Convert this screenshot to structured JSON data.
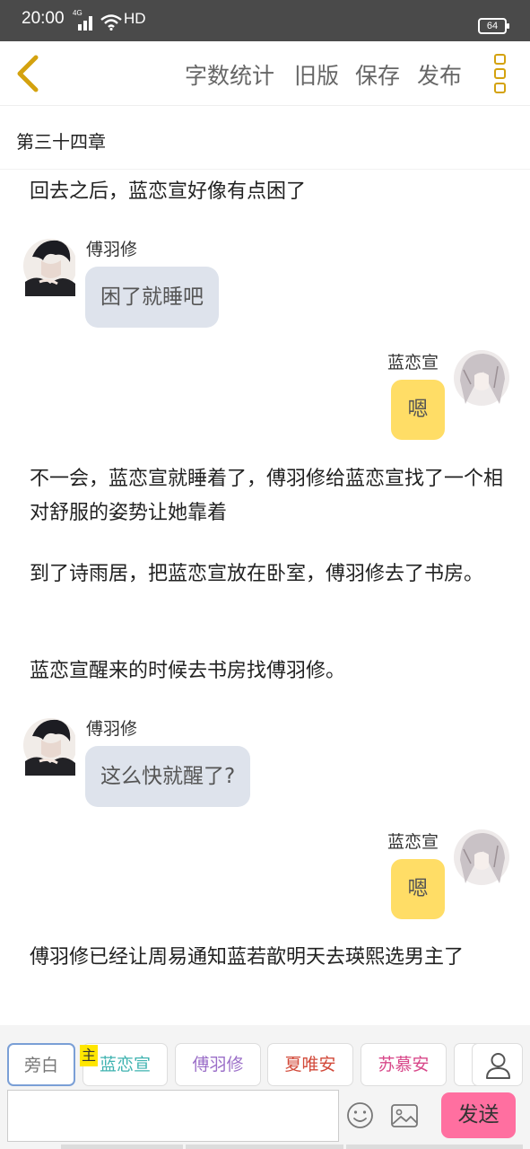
{
  "status_bar": {
    "time": "20:00",
    "network": "4G",
    "hd": "HD",
    "battery": "64"
  },
  "nav": {
    "back_icon": "chevron-left-icon",
    "actions": [
      "字数统计",
      "旧版",
      "保存",
      "发布"
    ],
    "menu_icon": "vertical-menu-icon",
    "accent": "#d4a20f"
  },
  "chapter": {
    "title": "第三十四章"
  },
  "messages": [
    {
      "type": "narration",
      "text": "回去之后，蓝恋宣好像有点困了"
    },
    {
      "type": "left",
      "speaker": "傅羽修",
      "text": "困了就睡吧"
    },
    {
      "type": "right",
      "speaker": "蓝恋宣",
      "text": "嗯"
    },
    {
      "type": "narration",
      "text": "不一会，蓝恋宣就睡着了，傅羽修给蓝恋宣找了一个相对舒服的姿势让她靠着"
    },
    {
      "type": "narration",
      "text": "到了诗雨居，把蓝恋宣放在卧室，傅羽修去了书房。"
    },
    {
      "type": "narration",
      "text": "蓝恋宣醒来的时候去书房找傅羽修。"
    },
    {
      "type": "left",
      "speaker": "傅羽修",
      "text": "这么快就醒了?"
    },
    {
      "type": "right",
      "speaker": "蓝恋宣",
      "text": "嗯"
    },
    {
      "type": "narration",
      "text": "傅羽修已经让周易通知蓝若歆明天去瑛熙选男主了"
    }
  ],
  "roles": {
    "main_badge": "主",
    "items": [
      {
        "label": "旁白",
        "color": "#777777"
      },
      {
        "label": "蓝恋宣",
        "color": "#3fb3b0"
      },
      {
        "label": "傅羽修",
        "color": "#9b6fc8"
      },
      {
        "label": "夏唯安",
        "color": "#d24a3a"
      },
      {
        "label": "苏慕安",
        "color": "#d8488a"
      }
    ],
    "user_icon": "user-icon"
  },
  "composer": {
    "input_value": "",
    "input_placeholder": "",
    "emoji_icon": "emoji-icon",
    "image_icon": "image-icon",
    "send_label": "发送",
    "send_color": "#ff6fa0"
  }
}
